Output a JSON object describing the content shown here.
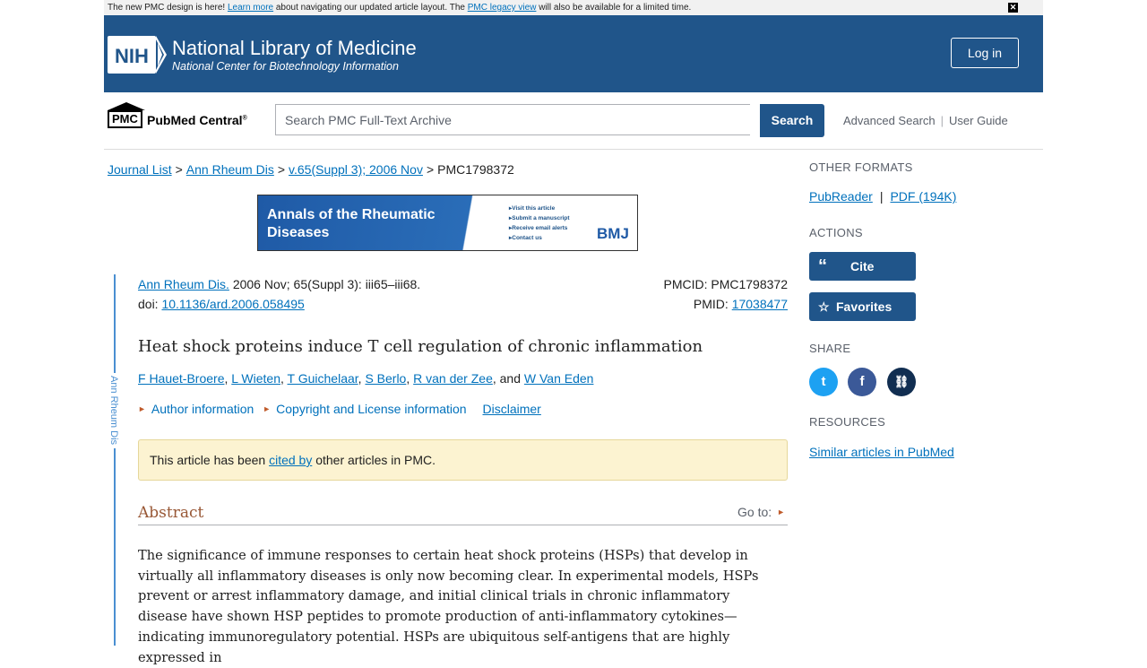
{
  "banner": {
    "pre": "The new PMC design is here! ",
    "link1": "Learn more",
    "mid": " about navigating our updated article layout. The ",
    "link2": "PMC legacy view",
    "post": " will also be available for a limited time.",
    "close": "✕"
  },
  "header": {
    "logo_text": "NIH",
    "title": "National Library of Medicine",
    "subtitle": "National Center for Biotechnology Information",
    "login": "Log in"
  },
  "search": {
    "logo_box": "PMC",
    "logo_name": "PubMed Central",
    "logo_reg": "®",
    "placeholder": "Search PMC Full-Text Archive",
    "button": "Search",
    "advanced": "Advanced Search",
    "guide": "User Guide"
  },
  "breadcrumb": {
    "items": [
      "Journal List",
      "Ann Rheum Dis",
      "v.65(Suppl 3); 2006 Nov"
    ],
    "current": "PMC1798372",
    "sep": ">"
  },
  "ad": {
    "title": "Annals of the Rheumatic Diseases",
    "links": [
      "Visit this article",
      "Submit a manuscript",
      "Receive email alerts",
      "Contact us"
    ],
    "brand": "BMJ"
  },
  "article": {
    "rail_label": "Ann Rheum Dis",
    "journal": "Ann Rheum Dis.",
    "citation": " 2006 Nov; 65(Suppl 3): iii65–iii68.",
    "doi_label": "doi: ",
    "doi": "10.1136/ard.2006.058495",
    "pmcid": "PMCID: PMC1798372",
    "pmid_label": "PMID: ",
    "pmid": "17038477",
    "title": "Heat shock proteins induce T cell regulation of chronic inflammation",
    "authors": [
      "F Hauet-Broere",
      "L Wieten",
      "T Guichelaar",
      "S Berlo",
      "R van der Zee",
      "W Van Eden"
    ],
    "author_sep": ", ",
    "author_and": ", and ",
    "author_info": "Author information",
    "copyright": "Copyright and License information",
    "disclaimer": "Disclaimer",
    "cited_pre": "This article has been ",
    "cited_link": "cited by",
    "cited_post": " other articles in PMC.",
    "abstract_heading": "Abstract",
    "goto": "Go to:",
    "abstract_text": "The significance of immune responses to certain heat shock proteins (HSPs) that develop in virtually all inflammatory diseases is only now becoming clear. In experimental models, HSPs prevent or arrest inflammatory damage, and initial clinical trials in chronic inflammatory disease have shown HSP peptides to promote production of anti-inflammatory cytokines—indicating immunoregulatory potential. HSPs are ubiquitous self-antigens that are highly expressed in"
  },
  "sidebar": {
    "other_formats": "OTHER FORMATS",
    "pubreader": "PubReader",
    "format_sep": "|",
    "pdf": "PDF (194K)",
    "actions": "ACTIONS",
    "cite": "Cite",
    "cite_icon": "“",
    "favorites": "Favorites",
    "favorites_icon": "☆",
    "share": "SHARE",
    "twitter_icon": "t",
    "facebook_icon": "f",
    "link_icon": "⛓",
    "resources": "RESOURCES",
    "similar": "Similar articles in PubMed"
  },
  "colors": {
    "header_bg": "#20558a",
    "link": "#0071bc",
    "twitter": "#1da1f2",
    "facebook": "#3b5998",
    "link_share": "#112e51",
    "cited_bg": "#fcf3d1",
    "abstract_heading": "#985735"
  }
}
